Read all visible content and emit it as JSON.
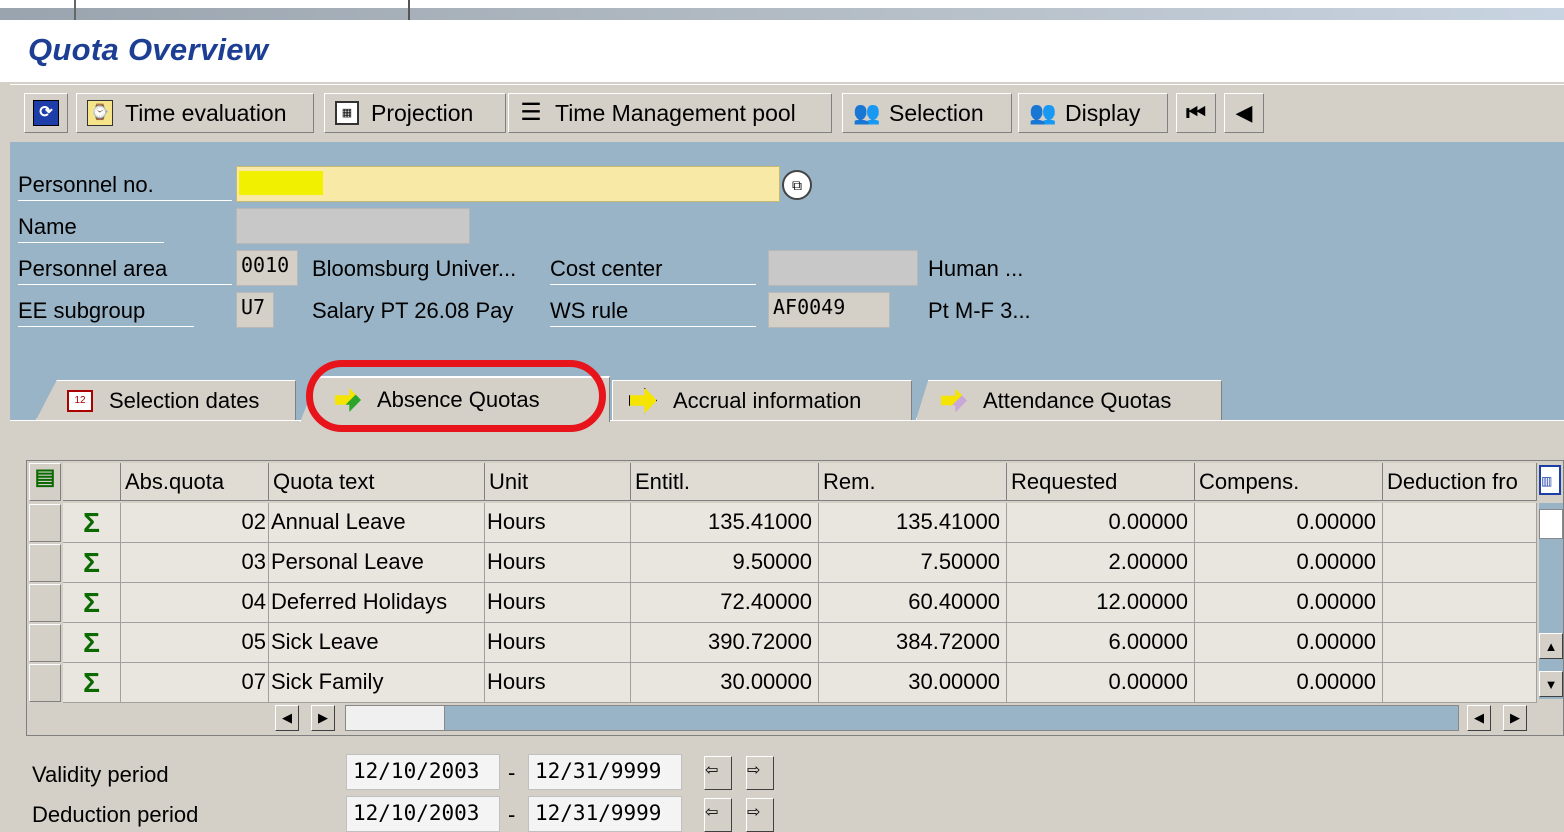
{
  "page": {
    "title": "Quota Overview"
  },
  "toolbar": {
    "buttons": [
      {
        "label": "",
        "icon": "refresh-icon"
      },
      {
        "label": "Time evaluation",
        "icon": "time-evaluation-icon"
      },
      {
        "label": "Projection",
        "icon": "calculator-icon"
      },
      {
        "label": "Time Management pool",
        "icon": "pool-icon"
      },
      {
        "label": "Selection",
        "icon": "people-icon"
      },
      {
        "label": "Display",
        "icon": "people-icon"
      },
      {
        "label": "",
        "icon": "first-record-icon"
      },
      {
        "label": "",
        "icon": "previous-record-icon"
      }
    ]
  },
  "header": {
    "personnel_no_label": "Personnel no.",
    "name_label": "Name",
    "personnel_area_label": "Personnel area",
    "personnel_area_code": "0010",
    "personnel_area_text": "Bloomsburg Univer...",
    "cost_center_label": "Cost center",
    "cost_center_text": "Human ...",
    "ee_subgroup_label": "EE subgroup",
    "ee_subgroup_code": "U7",
    "ee_subgroup_text": "Salary PT 26.08 Pay",
    "ws_rule_label": "WS rule",
    "ws_rule_code": "AF0049",
    "ws_rule_text": "Pt M-F 3..."
  },
  "tabs": [
    {
      "label": "Selection dates",
      "icon": "calendar-icon",
      "active": false
    },
    {
      "label": "Absence Quotas",
      "icon": "arrow-icon",
      "active": true
    },
    {
      "label": "Accrual information",
      "icon": "arrow-icon",
      "active": false
    },
    {
      "label": "Attendance Quotas",
      "icon": "arrow-icon",
      "active": false
    }
  ],
  "grid": {
    "columns": [
      "Abs.quota",
      "Quota text",
      "Unit",
      "Entitl.",
      "Rem.",
      "Requested",
      "Compens.",
      "Deduction fro"
    ],
    "rows": [
      {
        "abs_quota": "02",
        "quota_text": "Annual Leave",
        "unit": "Hours",
        "entitl": "135.41000",
        "rem": "135.41000",
        "requested": "0.00000",
        "compens": "0.00000",
        "deduction": ""
      },
      {
        "abs_quota": "03",
        "quota_text": "Personal Leave",
        "unit": "Hours",
        "entitl": "9.50000",
        "rem": "7.50000",
        "requested": "2.00000",
        "compens": "0.00000",
        "deduction": ""
      },
      {
        "abs_quota": "04",
        "quota_text": "Deferred Holidays",
        "unit": "Hours",
        "entitl": "72.40000",
        "rem": "60.40000",
        "requested": "12.00000",
        "compens": "0.00000",
        "deduction": ""
      },
      {
        "abs_quota": "05",
        "quota_text": "Sick Leave",
        "unit": "Hours",
        "entitl": "390.72000",
        "rem": "384.72000",
        "requested": "6.00000",
        "compens": "0.00000",
        "deduction": ""
      },
      {
        "abs_quota": "07",
        "quota_text": "Sick Family",
        "unit": "Hours",
        "entitl": "30.00000",
        "rem": "30.00000",
        "requested": "0.00000",
        "compens": "0.00000",
        "deduction": ""
      }
    ]
  },
  "footer": {
    "validity_label": "Validity period",
    "validity_from": "12/10/2003",
    "validity_to": "12/31/9999",
    "deduction_label": "Deduction period",
    "deduction_from": "12/10/2003",
    "deduction_to": "12/31/9999",
    "separator": "-"
  },
  "colors": {
    "header_bg": "#99b4c6",
    "title": "#1c3f93",
    "highlight_field": "#f8e9a6",
    "annotation": "#e8141c",
    "sum_icon": "#0a6a00"
  }
}
